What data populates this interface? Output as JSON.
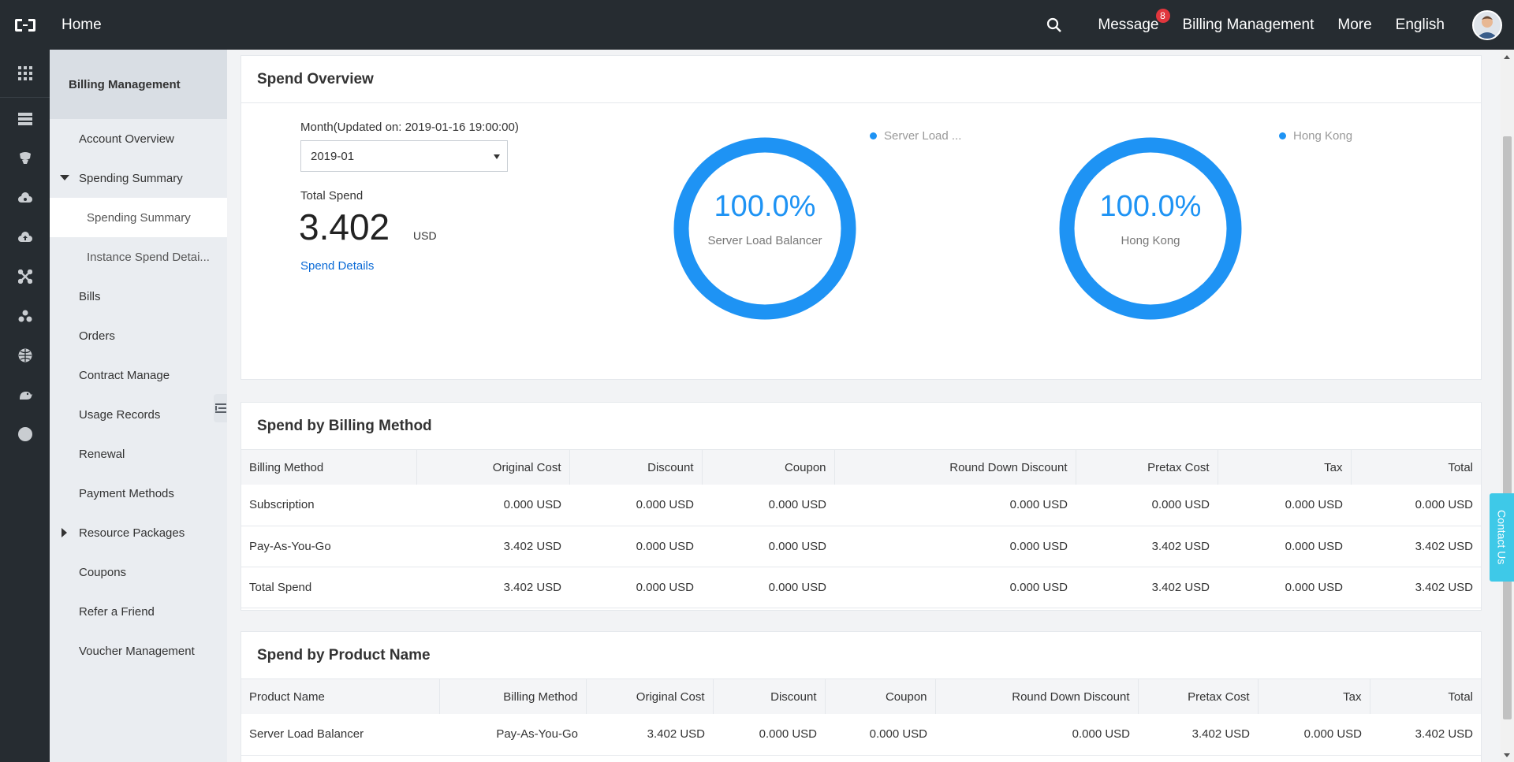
{
  "topbar": {
    "home_label": "Home",
    "message_label": "Message",
    "message_badge": "8",
    "billing_label": "Billing Management",
    "more_label": "More",
    "language_label": "English"
  },
  "rail": {
    "icons": [
      "grid-icon",
      "server-icon",
      "database-icon",
      "cloud-cog-icon",
      "cloud-upload-icon",
      "network-icon",
      "cluster-icon",
      "globe-icon",
      "dragon-icon",
      "circle-icon"
    ]
  },
  "sidebar": {
    "title": "Billing Management",
    "items": [
      {
        "label": "Account Overview"
      },
      {
        "label": "Spending Summary"
      },
      {
        "label": "Spending Summary"
      },
      {
        "label": "Instance Spend Detai..."
      },
      {
        "label": "Bills"
      },
      {
        "label": "Orders"
      },
      {
        "label": "Contract Manage"
      },
      {
        "label": "Usage Records"
      },
      {
        "label": "Renewal"
      },
      {
        "label": "Payment Methods"
      },
      {
        "label": "Resource Packages"
      },
      {
        "label": "Coupons"
      },
      {
        "label": "Refer a Friend"
      },
      {
        "label": "Voucher Management"
      }
    ]
  },
  "overview": {
    "title": "Spend Overview",
    "month_label": "Month(Updated on: 2019-01-16 19:00:00)",
    "month_value": "2019-01",
    "total_label": "Total Spend",
    "total_value": "3.402",
    "total_unit": "USD",
    "details_link": "Spend Details",
    "accent_color": "#1e93f4",
    "donuts": [
      {
        "percent": "100.0%",
        "caption": "Server Load Balancer",
        "legend": "Server Load ...",
        "fraction": 1.0
      },
      {
        "percent": "100.0%",
        "caption": "Hong Kong",
        "legend": "Hong Kong",
        "fraction": 1.0
      }
    ]
  },
  "billing_method": {
    "title": "Spend by Billing Method",
    "headers": [
      "Billing Method",
      "Original Cost",
      "Discount",
      "Coupon",
      "Round Down Discount",
      "Pretax Cost",
      "Tax",
      "Total"
    ],
    "rows": [
      [
        "Subscription",
        "0.000 USD",
        "0.000 USD",
        "0.000 USD",
        "0.000 USD",
        "0.000 USD",
        "0.000 USD",
        "0.000 USD"
      ],
      [
        "Pay-As-You-Go",
        "3.402 USD",
        "0.000 USD",
        "0.000 USD",
        "0.000 USD",
        "3.402 USD",
        "0.000 USD",
        "3.402 USD"
      ],
      [
        "Total Spend",
        "3.402 USD",
        "0.000 USD",
        "0.000 USD",
        "0.000 USD",
        "3.402 USD",
        "0.000 USD",
        "3.402 USD"
      ]
    ]
  },
  "product_name": {
    "title": "Spend by Product Name",
    "headers": [
      "Product Name",
      "Billing Method",
      "Original Cost",
      "Discount",
      "Coupon",
      "Round Down Discount",
      "Pretax Cost",
      "Tax",
      "Total"
    ],
    "rows": [
      [
        "Server Load Balancer",
        "Pay-As-You-Go",
        "3.402 USD",
        "0.000 USD",
        "0.000 USD",
        "0.000 USD",
        "3.402 USD",
        "0.000 USD",
        "3.402 USD"
      ]
    ]
  },
  "contact_label": "Contact Us"
}
